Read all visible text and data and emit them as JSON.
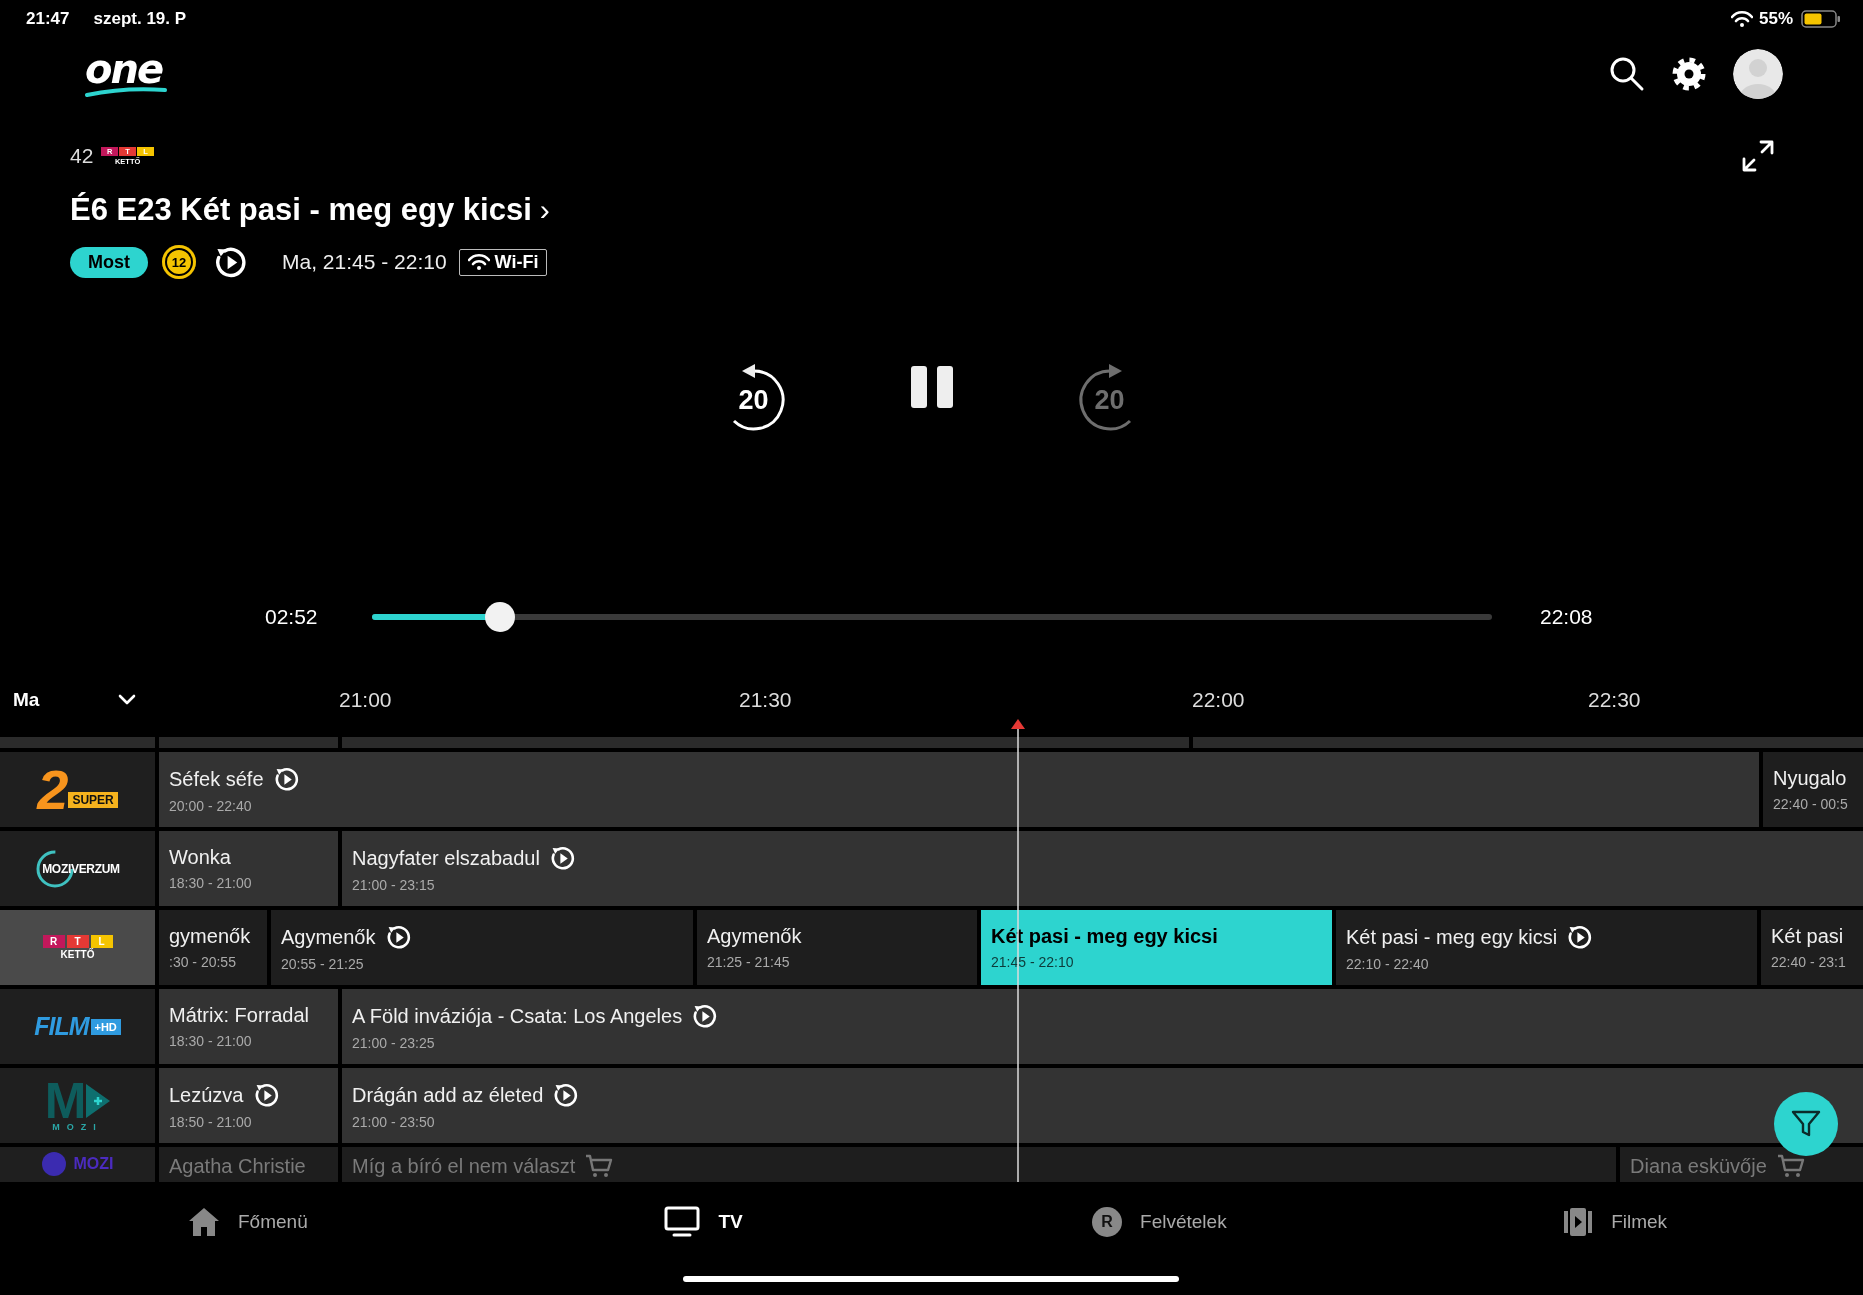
{
  "status_bar": {
    "time": "21:47",
    "date": "szept. 19. P",
    "battery": "55%"
  },
  "header": {
    "logo": "one"
  },
  "now_playing": {
    "channel_number": "42",
    "channel_logo": {
      "kind": "rtl",
      "parts": [
        "R",
        "T",
        "L",
        "KETTŐ"
      ]
    },
    "title": "É6 E23 Két pasi - meg egy kicsi",
    "chevron": "›",
    "live_badge": "Most",
    "age_rating": "12",
    "time": "Ma, 21:45 - 22:10",
    "connection": "Wi-Fi"
  },
  "controls": {
    "rewind": "20",
    "forward": "20",
    "forward_disabled": true
  },
  "progress": {
    "elapsed": "02:52",
    "level": 0.114,
    "end": "22:08"
  },
  "guide": {
    "day": "Ma",
    "times": [
      "21:00",
      "21:30",
      "22:00",
      "22:30"
    ],
    "channels": [
      {
        "logo": {
          "kind": "super",
          "parts": [
            "2",
            "SUPER"
          ]
        },
        "selected": false,
        "locked": false,
        "programs": [
          {
            "title": "Séfek séfe",
            "time": "20:00 - 22:40",
            "kind": "replay",
            "selected": false
          },
          {
            "title": "Nyugalo",
            "time": "22:40 - 00:5",
            "kind": "plain",
            "selected": false
          }
        ]
      },
      {
        "logo": {
          "kind": "moziverzum",
          "parts": [
            "MOZIVERZUM"
          ]
        },
        "selected": false,
        "locked": false,
        "programs": [
          {
            "title": "Wonka",
            "time": "18:30 - 21:00",
            "kind": "plain",
            "selected": false
          },
          {
            "title": "Nagyfater elszabadul",
            "time": "21:00 - 23:15",
            "kind": "replay",
            "selected": false
          }
        ]
      },
      {
        "logo": {
          "kind": "rtl",
          "parts": [
            "R",
            "T",
            "L",
            "KETTŐ"
          ]
        },
        "selected": true,
        "locked": false,
        "programs": [
          {
            "title": "gymenők",
            "time": ":30 - 20:55",
            "kind": "plain",
            "selected": false
          },
          {
            "title": "Agymenők",
            "time": "20:55 - 21:25",
            "kind": "replay",
            "selected": false
          },
          {
            "title": "Agymenők",
            "time": "21:25 - 21:45",
            "kind": "plain",
            "selected": false
          },
          {
            "title": "Két pasi - meg egy kicsi",
            "time": "21:45 - 22:10",
            "kind": "plain",
            "selected": true
          },
          {
            "title": "Két pasi - meg egy kicsi",
            "time": "22:10 - 22:40",
            "kind": "replay",
            "selected": false
          },
          {
            "title": "Két pasi",
            "time": "22:40 - 23:1",
            "kind": "plain",
            "selected": false
          }
        ]
      },
      {
        "logo": {
          "kind": "film",
          "parts": [
            "FILM",
            "+HD"
          ]
        },
        "selected": false,
        "locked": false,
        "programs": [
          {
            "title": "Mátrix: Forradal",
            "time": "18:30 - 21:00",
            "kind": "plain",
            "selected": false
          },
          {
            "title": "A Föld inváziója - Csata: Los Angeles",
            "time": "21:00 - 23:25",
            "kind": "replay",
            "selected": false
          }
        ]
      },
      {
        "logo": {
          "kind": "mplus",
          "parts": [
            "M",
            "MOZI"
          ]
        },
        "selected": false,
        "locked": false,
        "programs": [
          {
            "title": "Lezúzva",
            "time": "18:50 - 21:00",
            "kind": "replay",
            "selected": false
          },
          {
            "title": "Drágán add az életed",
            "time": "21:00 - 23:50",
            "kind": "replay",
            "selected": false
          }
        ]
      },
      {
        "logo": {
          "kind": "mozi",
          "parts": [
            "MOZI"
          ]
        },
        "selected": false,
        "locked": true,
        "programs": [
          {
            "title": "Agatha Christie",
            "kind": "plain",
            "selected": false
          },
          {
            "title": "Míg a bíró el nem választ",
            "kind": "cart",
            "selected": false
          },
          {
            "title": "Diana esküvője",
            "kind": "cart",
            "selected": false
          }
        ]
      }
    ]
  },
  "nav": [
    {
      "kind": "home",
      "label": "Főmenü",
      "selected": false
    },
    {
      "kind": "tv",
      "label": "TV",
      "selected": true
    },
    {
      "kind": "recordings",
      "icon_text": "R",
      "label": "Felvételek",
      "selected": false
    },
    {
      "kind": "movies",
      "label": "Filmek",
      "selected": false
    }
  ]
}
